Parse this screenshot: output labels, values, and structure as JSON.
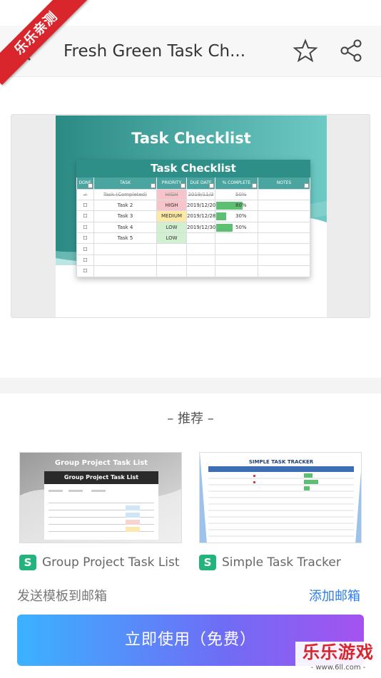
{
  "header": {
    "title": "Fresh Green Task Ch...",
    "ribbon": "乐乐亲测"
  },
  "preview": {
    "banner_title": "Task Checklist",
    "table_title": "Task Checklist",
    "columns": [
      "DONE",
      "TASK",
      "PRIORITY",
      "DUE DATE",
      "% COMPLETE",
      "NOTES"
    ],
    "rows": [
      {
        "done": "✓",
        "task": "Task (Completed)",
        "priority": "HIGH",
        "due": "2019/11/3",
        "pct": "50%",
        "pct_value": 50,
        "completed": true
      },
      {
        "done": "☐",
        "task": "Task 2",
        "priority": "HIGH",
        "due": "2019/12/20",
        "pct": "80%",
        "pct_value": 80
      },
      {
        "done": "☐",
        "task": "Task 3",
        "priority": "MEDIUM",
        "due": "2019/12/28",
        "pct": "30%",
        "pct_value": 30
      },
      {
        "done": "☐",
        "task": "Task 4",
        "priority": "LOW",
        "due": "2019/12/30",
        "pct": "50%",
        "pct_value": 50
      },
      {
        "done": "☐",
        "task": "Task 5",
        "priority": "LOW",
        "due": "",
        "pct": "",
        "pct_value": 0
      },
      {
        "done": "☐",
        "task": "",
        "priority": "",
        "due": "",
        "pct": "",
        "pct_value": 0
      },
      {
        "done": "☐",
        "task": "",
        "priority": "",
        "due": "",
        "pct": "",
        "pct_value": 0
      },
      {
        "done": "☐",
        "task": "",
        "priority": "",
        "due": "",
        "pct": "",
        "pct_value": 0
      }
    ]
  },
  "recommend": {
    "title": "– 推荐 –",
    "cards": [
      {
        "label": "Group Project Task List",
        "thumb_title": "Group Project Task List",
        "thumb_subtitle": "Group Project Task List"
      },
      {
        "label": "Simple Task Tracker",
        "thumb_title": "SIMPLE TASK TRACKER"
      }
    ]
  },
  "actions": {
    "send_label": "发送模板到邮箱",
    "add_mail": "添加邮箱",
    "cta": "立即使用（免费）"
  },
  "watermark": {
    "main": "乐乐游戏",
    "sub": "- www.6ll.com -"
  },
  "colors": {
    "teal": "#2e8f88",
    "cta_start": "#3bb2ff",
    "cta_end": "#a552ef",
    "link": "#2b7de9",
    "doc_icon": "#23b37c"
  }
}
